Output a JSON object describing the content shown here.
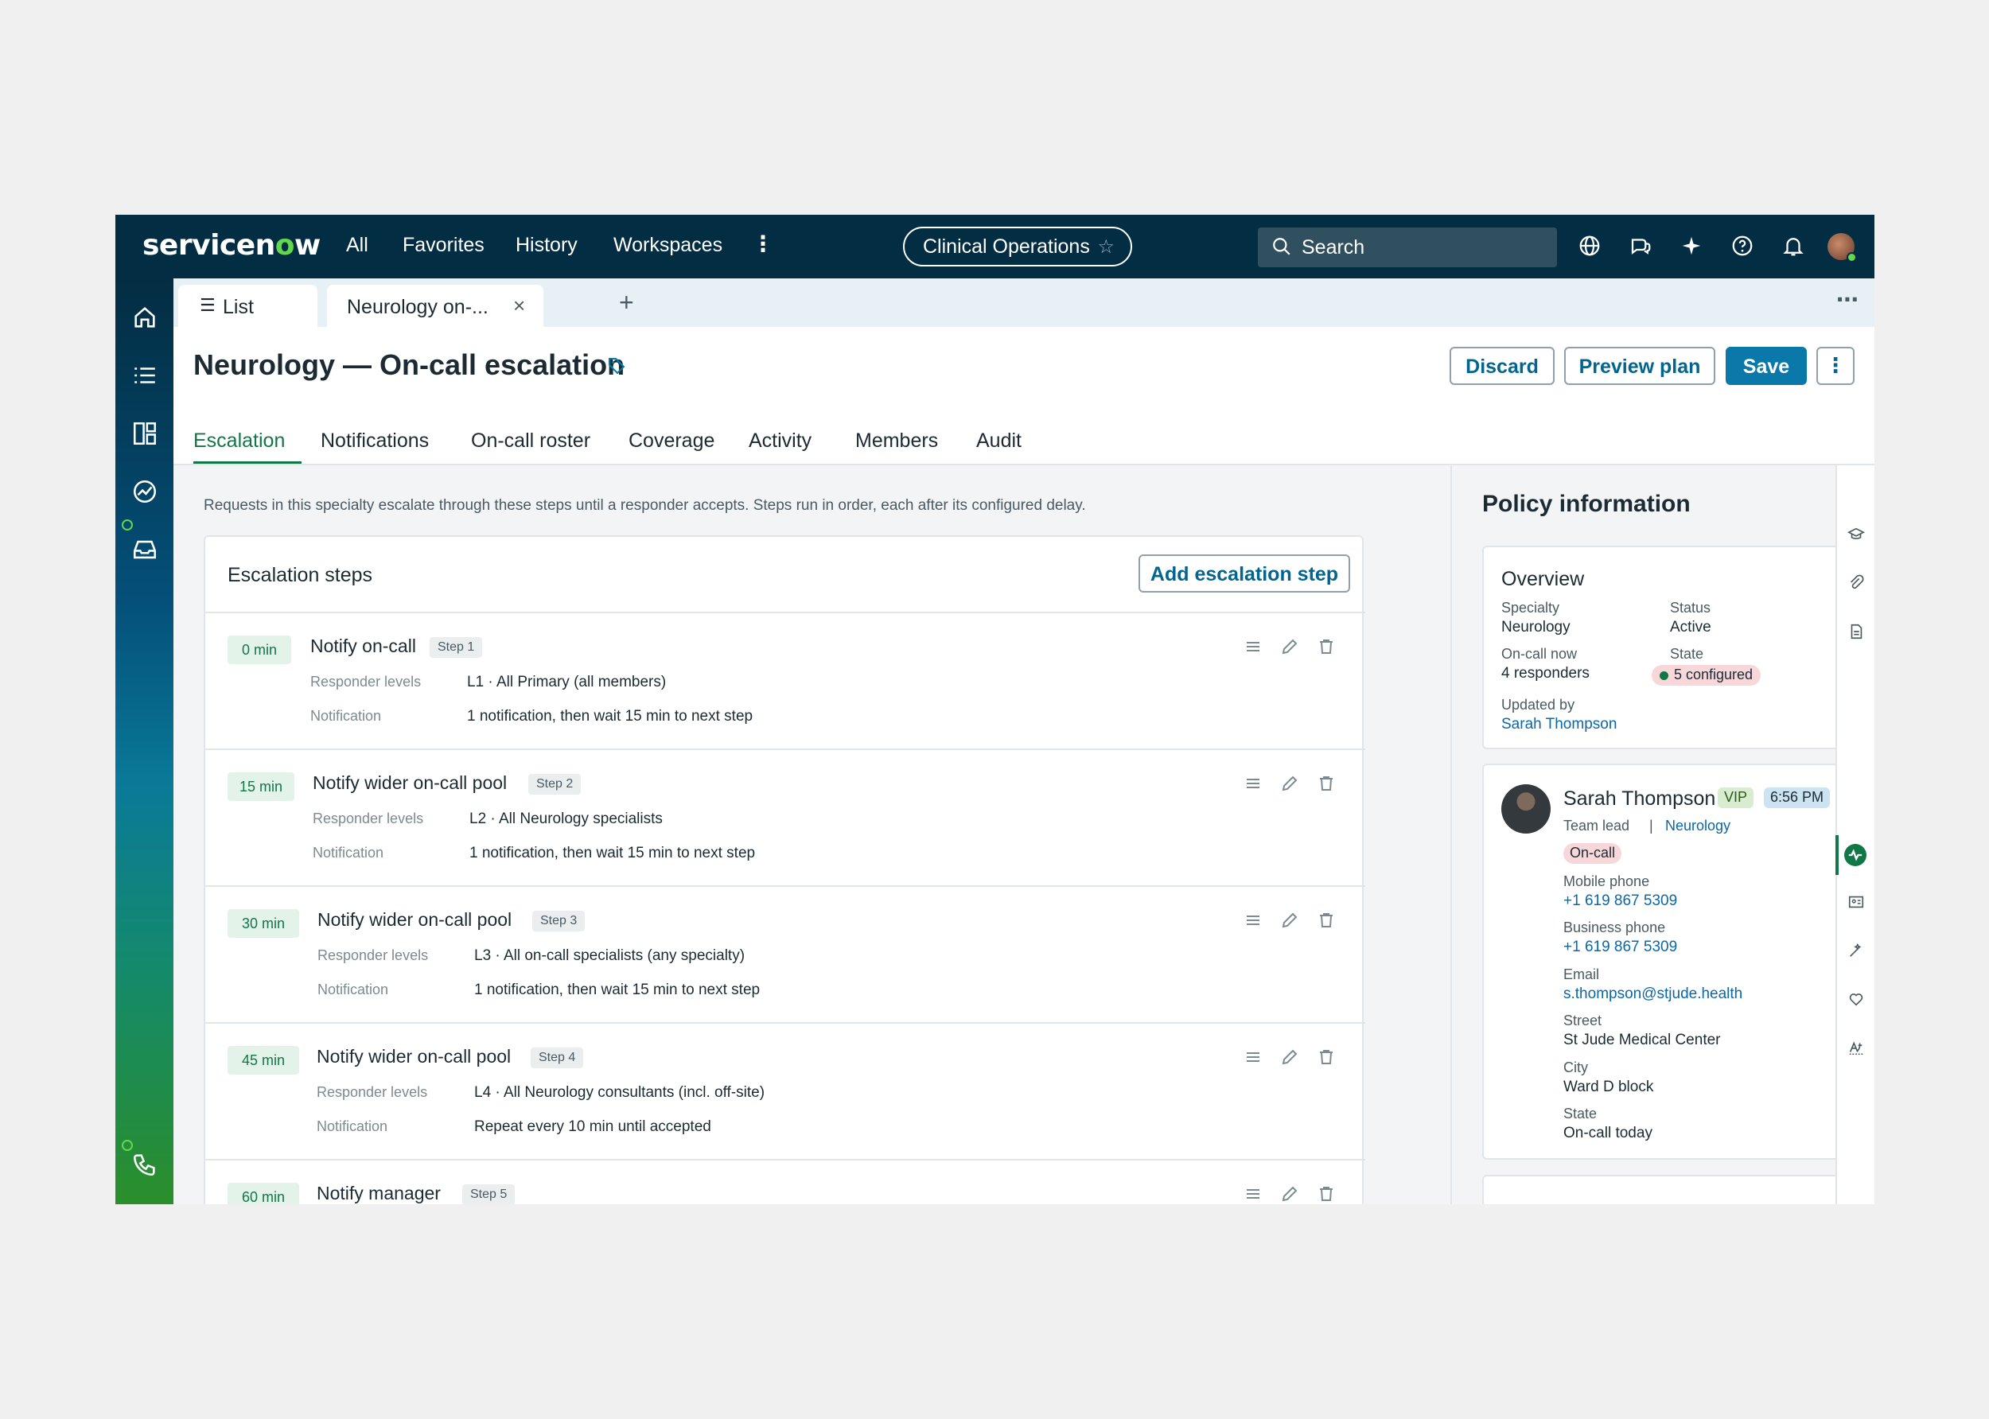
{
  "topnav": {
    "logo": "servicenow",
    "links": [
      "All",
      "Favorites",
      "History",
      "Workspaces"
    ],
    "workspace": "Clinical Operations",
    "search_placeholder": "Search"
  },
  "tabs": {
    "list_label": "List",
    "record_label": "Neurology on-..."
  },
  "header": {
    "title": "Neurology — On-call escalation",
    "discard": "Discard",
    "preview": "Preview plan",
    "save": "Save"
  },
  "section_tabs": [
    "Escalation",
    "Notifications",
    "On-call roster",
    "Coverage",
    "Activity",
    "Members",
    "Audit"
  ],
  "main": {
    "description": "Requests in this specialty escalate through these steps until a responder accepts. Steps run in order, each after its configured delay.",
    "card_title": "Escalation steps",
    "add_button": "Add escalation step",
    "responder_label": "Responder levels",
    "notification_label": "Notification",
    "steps": [
      {
        "delay": "0 min",
        "title": "Notify on-call",
        "badge": "Step 1",
        "responders": "L1 · All Primary (all members)",
        "notification": "1 notification, then wait 15 min to next step"
      },
      {
        "delay": "15 min",
        "title": "Notify wider on-call pool",
        "badge": "Step 2",
        "responders": "L2 · All Neurology specialists",
        "notification": "1 notification, then wait 15 min to next step"
      },
      {
        "delay": "30 min",
        "title": "Notify wider on-call pool",
        "badge": "Step 3",
        "responders": "L3 · All on-call specialists (any specialty)",
        "notification": "1 notification, then wait 15 min to next step"
      },
      {
        "delay": "45 min",
        "title": "Notify wider on-call pool",
        "badge": "Step 4",
        "responders": "L4 · All Neurology consultants (incl. off-site)",
        "notification": "Repeat every 10 min until accepted"
      },
      {
        "delay": "60 min",
        "title": "Notify manager",
        "badge": "Step 5",
        "responders": "",
        "notification": ""
      }
    ]
  },
  "policy": {
    "title": "Policy information",
    "overview_title": "Overview",
    "specialty_label": "Specialty",
    "specialty": "Neurology",
    "status_label": "Status",
    "status": "Active",
    "oncall_label": "On-call now",
    "oncall": "4 responders",
    "state_label": "State",
    "state": "5 configured",
    "updated_label": "Updated by",
    "updated_by": "Sarah Thompson"
  },
  "contact": {
    "name": "Sarah Thompson",
    "vip": "VIP",
    "time": "6:56 PM",
    "role": "Team lead",
    "separator": "|",
    "dept": "Neurology",
    "status": "On-call",
    "mobile_label": "Mobile phone",
    "mobile": "+1 619 867 5309",
    "business_label": "Business phone",
    "business": "+1 619 867 5309",
    "email_label": "Email",
    "email": "s.thompson@stjude.health",
    "street_label": "Street",
    "street": "St Jude Medical Center",
    "city_label": "City",
    "city": "Ward D block",
    "state_label": "State",
    "state": "On-call today"
  },
  "colors": {
    "nav": "#032d42",
    "accent": "#0a78a8",
    "success": "#117747"
  }
}
